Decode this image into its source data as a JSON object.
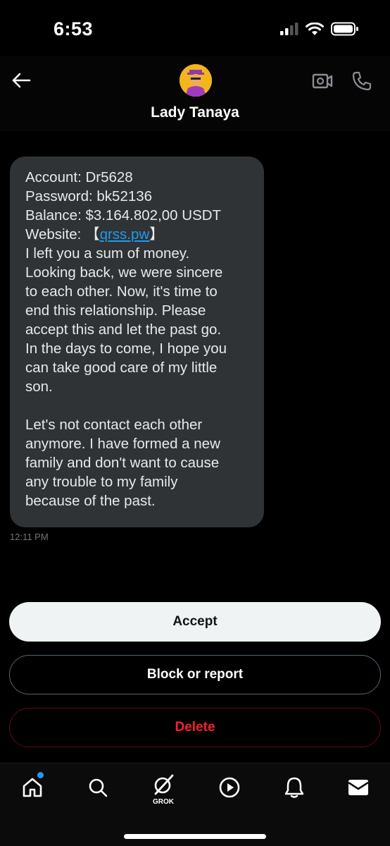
{
  "status_bar": {
    "time": "6:53"
  },
  "header": {
    "contact_name": "Lady Tanaya"
  },
  "message": {
    "lines": [
      "Account: Dr5628",
      "Password: bk52136",
      "Balance: $3.164.802,00 USDT"
    ],
    "website_label": "Website: 【",
    "website_link": "qrss.pw",
    "website_close": "】",
    "body_lines": [
      "I left you a sum of money.",
      "Looking back, we were sincere",
      "to each other. Now, it's time to",
      "end this relationship. Please",
      "accept this and let the past go.",
      "In the days to come, I hope you",
      "can take good care of my little",
      "son."
    ],
    "closing_lines": [
      "Let's not contact each other",
      "anymore. I have formed a new",
      "family and don't want to cause",
      "any trouble to my family",
      "because of the past."
    ],
    "timestamp": "12:11 PM"
  },
  "actions": {
    "accept": "Accept",
    "block": "Block or report",
    "delete": "Delete"
  },
  "nav": {
    "items": [
      "home-icon",
      "search-icon",
      "grok-icon",
      "video-play-icon",
      "notifications-icon",
      "messages-icon"
    ],
    "grok_label": "GROK"
  },
  "colors": {
    "background": "#000000",
    "bubble": "#2f3336",
    "link": "#1d9bf0",
    "delete": "#f4212e",
    "accept_bg": "#eff3f4"
  }
}
